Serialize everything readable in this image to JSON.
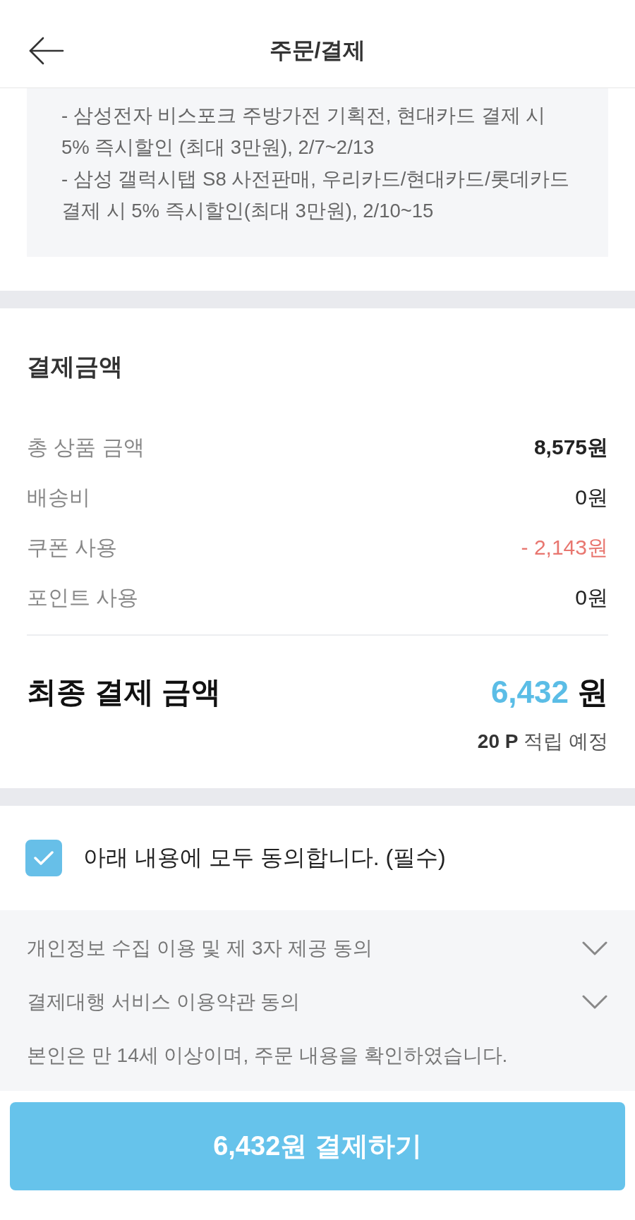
{
  "header": {
    "title": "주문/결제"
  },
  "notice": {
    "lines": [
      "- 삼성전자 비스포크 주방가전 기획전, 현대카드 결제 시 5% 즉시할인 (최대 3만원), 2/7~2/13",
      "- 삼성 갤럭시탭 S8 사전판매, 우리카드/현대카드/롯데카드 결제 시 5% 즉시할인(최대 3만원), 2/10~15"
    ]
  },
  "payment": {
    "title": "결제금액",
    "rows": [
      {
        "kind": "emphasis",
        "label": "총 상품 금액",
        "value": "8,575원"
      },
      {
        "kind": "normal",
        "label": "배송비",
        "value": "0원"
      },
      {
        "kind": "discount",
        "label": "쿠폰 사용",
        "value": "- 2,143원"
      },
      {
        "kind": "normal",
        "label": "포인트 사용",
        "value": "0원"
      }
    ],
    "total": {
      "label": "최종 결제 금액",
      "amount": "6,432",
      "unit": "원",
      "points": "**20 P** 적립 예정"
    }
  },
  "agreement": {
    "all": {
      "label": "아래 내용에 모두 동의합니다. (필수)",
      "checked": true
    },
    "items": [
      {
        "kind": "expandable",
        "label": "개인정보 수집 이용 및 제 3자 제공 동의",
        "expanded": false
      },
      {
        "kind": "expandable",
        "label": "결제대행 서비스 이용약관 동의",
        "expanded": false
      },
      {
        "kind": "note",
        "label": "본인은 만 14세 이상이며, 주문 내용을 확인하였습니다."
      }
    ]
  },
  "pay_button": {
    "label": "6,432원 결제하기"
  }
}
